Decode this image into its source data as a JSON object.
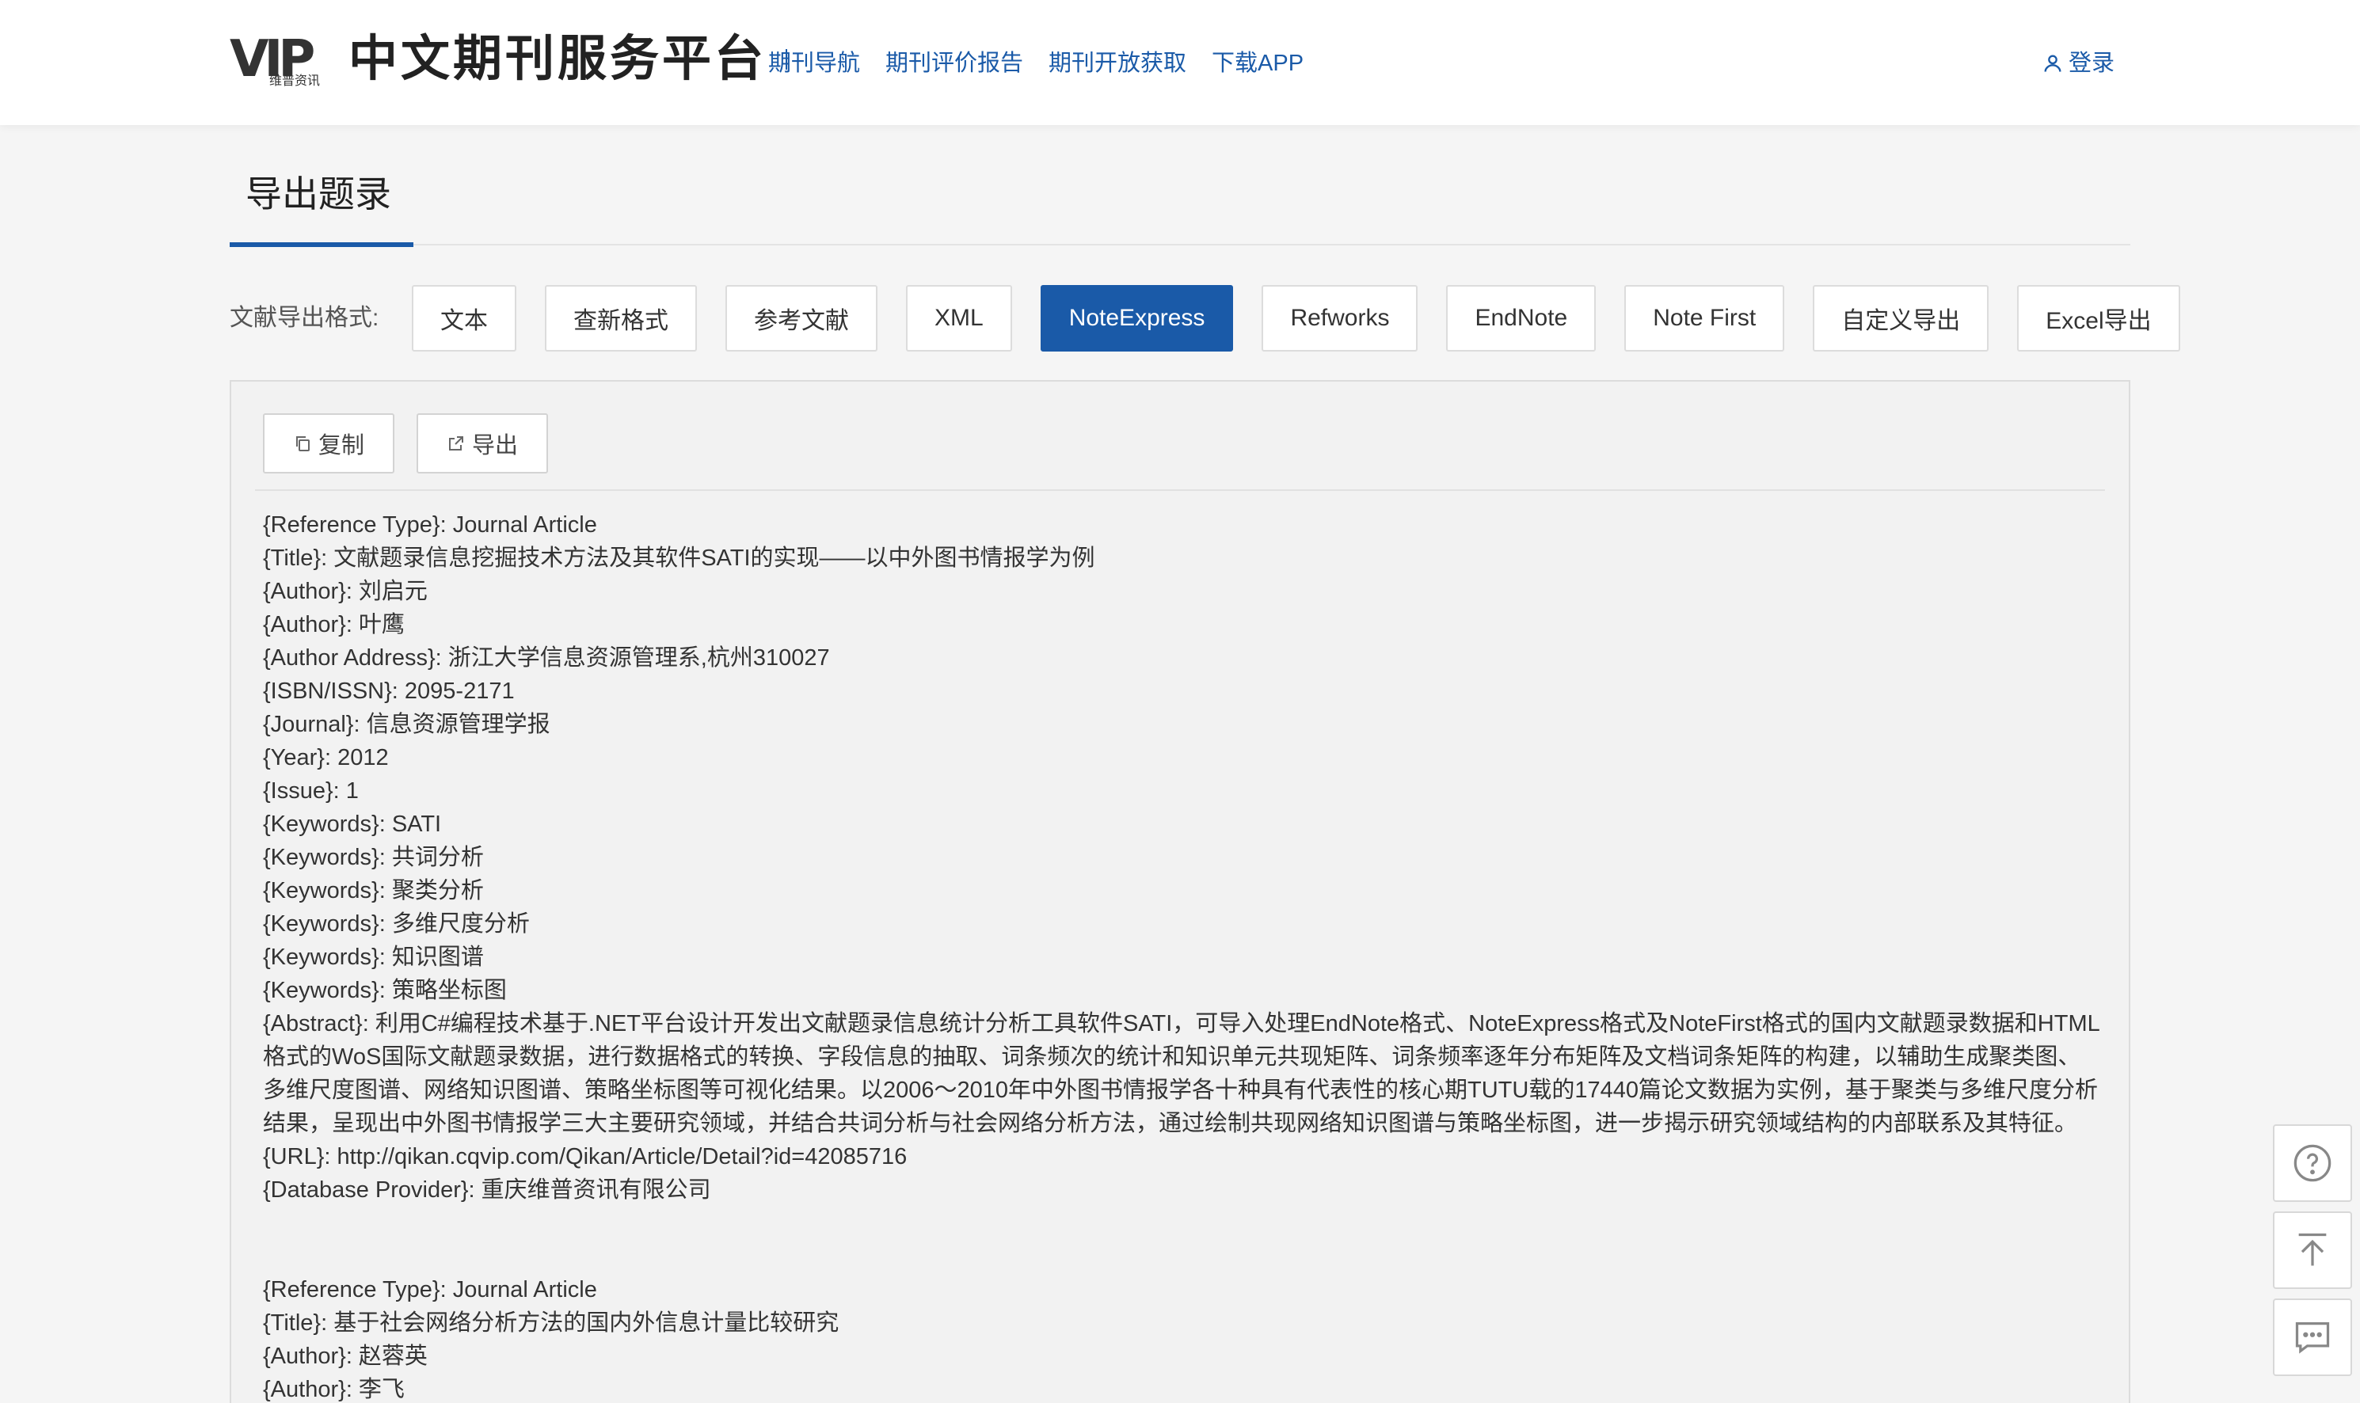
{
  "header": {
    "logo_mark": "VIP",
    "logo_sub": "维普资讯",
    "site_title": "中文期刊服务平台",
    "nav": [
      {
        "label": "期刊导航"
      },
      {
        "label": "期刊评价报告"
      },
      {
        "label": "期刊开放获取"
      },
      {
        "label": "下载APP"
      }
    ],
    "login_label": "登录",
    "accent_color": "#1a5aa8"
  },
  "page": {
    "title": "导出题录"
  },
  "format_bar": {
    "label": "文献导出格式:",
    "options": [
      {
        "label": "文本"
      },
      {
        "label": "查新格式"
      },
      {
        "label": "参考文献"
      },
      {
        "label": "XML"
      },
      {
        "label": "NoteExpress"
      },
      {
        "label": "Refworks"
      },
      {
        "label": "EndNote"
      },
      {
        "label": "Note First"
      },
      {
        "label": "自定义导出"
      },
      {
        "label": "Excel导出"
      }
    ],
    "selected": "NoteExpress"
  },
  "toolbar": {
    "copy_label": "复制",
    "export_label": "导出"
  },
  "records": [
    {
      "lines": [
        "{Reference Type}: Journal Article",
        "{Title}: 文献题录信息挖掘技术方法及其软件SATI的实现——以中外图书情报学为例",
        "{Author}: 刘启元",
        "{Author}: 叶鹰",
        "{Author Address}: 浙江大学信息资源管理系,杭州310027",
        "{ISBN/ISSN}: 2095-2171",
        "{Journal}: 信息资源管理学报",
        "{Year}: 2012",
        "{Issue}: 1",
        "{Keywords}: SATI",
        "{Keywords}: 共词分析",
        "{Keywords}: 聚类分析",
        "{Keywords}: 多维尺度分析",
        "{Keywords}: 知识图谱",
        "{Keywords}: 策略坐标图",
        "{Abstract}: 利用C#编程技术基于.NET平台设计开发出文献题录信息统计分析工具软件SATI，可导入处理EndNote格式、NoteExpress格式及NoteFirst格式的国内文献题录数据和HTML格式的WoS国际文献题录数据，进行数据格式的转换、字段信息的抽取、词条频次的统计和知识单元共现矩阵、词条频率逐年分布矩阵及文档词条矩阵的构建，以辅助生成聚类图、多维尺度图谱、网络知识图谱、策略坐标图等可视化结果。以2006～2010年中外图书情报学各十种具有代表性的核心期TUTU载的17440篇论文数据为实例，基于聚类与多维尺度分析结果，呈现出中外图书情报学三大主要研究领域，并结合共词分析与社会网络分析方法，通过绘制共现网络知识图谱与策略坐标图，进一步揭示研究领域结构的内部联系及其特征。",
        "{URL}: http://qikan.cqvip.com/Qikan/Article/Detail?id=42085716",
        "{Database Provider}: 重庆维普资讯有限公司"
      ]
    },
    {
      "lines": [
        "{Reference Type}: Journal Article",
        "{Title}: 基于社会网络分析方法的国内外信息计量比较研究",
        "{Author}: 赵蓉英",
        "{Author}: 李飞"
      ]
    }
  ],
  "float_tools": [
    {
      "icon": "help-icon"
    },
    {
      "icon": "back-to-top-icon"
    },
    {
      "icon": "feedback-icon"
    }
  ]
}
